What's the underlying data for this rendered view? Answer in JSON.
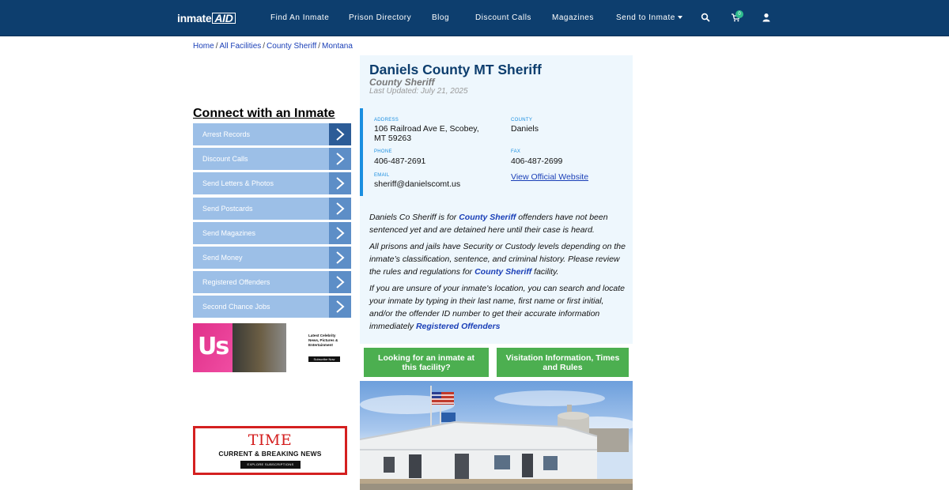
{
  "nav": {
    "logo_text": "inmate",
    "logo_box_text": "AID",
    "links": [
      "Find An Inmate",
      "Prison Directory",
      "Blog",
      "Discount Calls",
      "Magazines",
      "Send to Inmate"
    ],
    "cart_count": "0",
    "icons": [
      "search-icon",
      "cart-icon",
      "user-icon"
    ]
  },
  "breadcrumb": [
    "Home",
    "All Facilities",
    "County Sheriff",
    "Montana"
  ],
  "sidebar": {
    "title": "Connect with an Inmate",
    "items": [
      "Arrest Records",
      "Discount Calls",
      "Send Letters & Photos",
      "Send Postcards",
      "Send Magazines",
      "Send Money",
      "Registered Offenders",
      "Second Chance Jobs"
    ]
  },
  "ads": {
    "us": {
      "logo": "Us",
      "text": "Latest Celebrity News, Pictures & Entertainment",
      "button": "Subscribe Now"
    },
    "time": {
      "logo": "TIME",
      "subtitle": "CURRENT & BREAKING NEWS",
      "button": "EXPLORE SUBSCRIPTIONS"
    }
  },
  "facility": {
    "title": "Daniels County MT Sheriff",
    "type": "County Sheriff",
    "updated": "Last Updated: July 21, 2025",
    "address_label": "ADDRESS",
    "address_line1": "106 Railroad Ave E, Scobey,",
    "address_line2": "MT 59263",
    "county_label": "COUNTY",
    "county": "Daniels",
    "phone_label": "PHONE",
    "phone": "406-487-2691",
    "fax_label": "FAX",
    "fax": "406-487-2699",
    "email_label": "EMAIL",
    "email": "sheriff@danielscomt.us",
    "website_link": "View Official Website"
  },
  "description": {
    "p1_pre": "Daniels Co Sheriff is for ",
    "p1_link": "County Sheriff",
    "p1_post": " offenders have not been sentenced yet and are detained here until their case is heard.",
    "p2_pre": "All prisons and jails have Security or Custody levels depending on the inmate’s classification, sentence, and criminal history. Please review the rules and regulations for ",
    "p2_link": "County Sheriff",
    "p2_post": " facility.",
    "p3_pre": "If you are unsure of your inmate's location, you can search and locate your inmate by typing in their last name, first name or first initial, and/or the offender ID number to get their accurate information immediately ",
    "p3_link": "Registered Offenders"
  },
  "buttons": {
    "find_inmate": "Looking for an inmate at this facility?",
    "visitation": "Visitation Information, Times and Rules"
  },
  "colors": {
    "nav_bg": "#0d3e6e",
    "sidebar_item": "#9cbfe7",
    "sidebar_arrow": "#5d8ec7",
    "panel_bg": "#eef7fd",
    "accent": "#1a8ee0",
    "button_green": "#4caf50",
    "link": "#1a3fb7"
  }
}
